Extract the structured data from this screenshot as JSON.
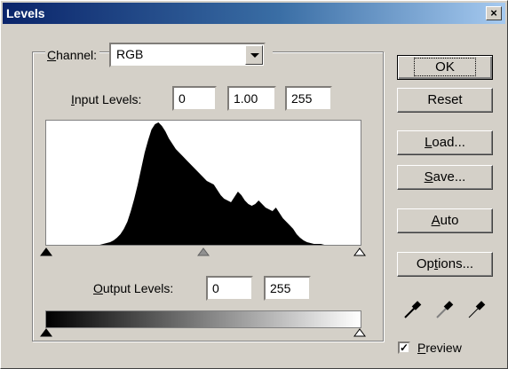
{
  "window": {
    "title": "Levels",
    "close_glyph": "×"
  },
  "channel": {
    "label_accel": "C",
    "label_rest": "hannel:",
    "value": "RGB"
  },
  "input_levels": {
    "label_accel": "I",
    "label_rest": "nput Levels:",
    "black": "0",
    "gamma": "1.00",
    "white": "255"
  },
  "output_levels": {
    "label_accel": "O",
    "label_rest": "utput Levels:",
    "black": "0",
    "white": "255"
  },
  "histogram": {
    "values": [
      0,
      0,
      0,
      0,
      0,
      0,
      0,
      0,
      0,
      0,
      0,
      0,
      0,
      0,
      0,
      0,
      1,
      2,
      3,
      5,
      8,
      12,
      18,
      26,
      38,
      52,
      68,
      86,
      104,
      118,
      130,
      136,
      138,
      134,
      128,
      120,
      114,
      108,
      104,
      100,
      96,
      92,
      88,
      84,
      80,
      76,
      72,
      70,
      68,
      62,
      56,
      52,
      50,
      48,
      54,
      60,
      56,
      50,
      46,
      44,
      46,
      50,
      46,
      42,
      40,
      38,
      42,
      36,
      30,
      26,
      22,
      18,
      12,
      8,
      5,
      3,
      2,
      1,
      1,
      1,
      0,
      0,
      0,
      0,
      0,
      0,
      0,
      0,
      0,
      0,
      0
    ]
  },
  "buttons": {
    "ok": {
      "label": "OK"
    },
    "reset": {
      "label": "Reset"
    },
    "load": {
      "accel": "L",
      "rest": "oad..."
    },
    "save": {
      "accel": "S",
      "rest": "ave..."
    },
    "auto": {
      "accel": "A",
      "rest": "uto"
    },
    "options": {
      "pre": "Op",
      "accel": "t",
      "rest": "ions..."
    }
  },
  "preview": {
    "checked": true,
    "check_glyph": "✓",
    "label_accel": "P",
    "label_rest": "review"
  }
}
